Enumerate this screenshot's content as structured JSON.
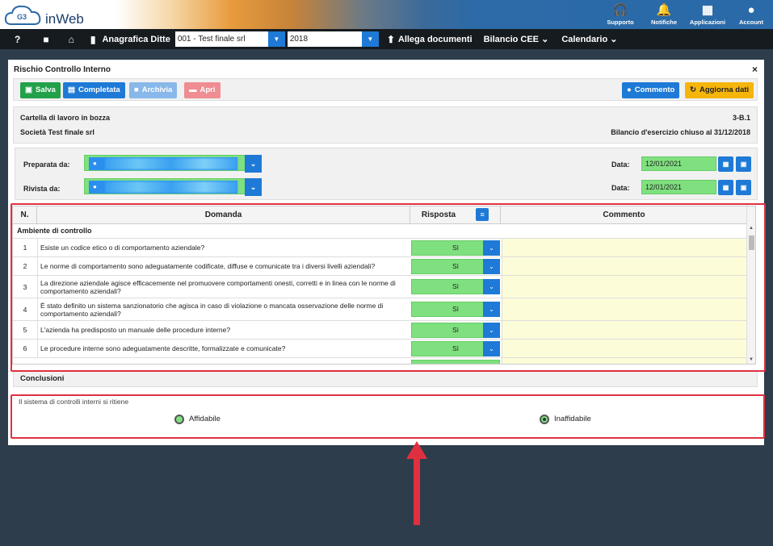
{
  "app": {
    "logo_text": "inWeb",
    "logo_mark": "G3"
  },
  "top_icons": [
    {
      "label": "Supporto",
      "icon": "headset-icon"
    },
    {
      "label": "Notifiche",
      "icon": "bell-icon"
    },
    {
      "label": "Applicazioni",
      "icon": "grid-icon"
    },
    {
      "label": "Account",
      "icon": "user-icon"
    }
  ],
  "nav": {
    "help": "?",
    "anagrafica": "Anagrafica Ditte",
    "company": "001 - Test finale srl",
    "year": "2018",
    "allega": "Allega documenti",
    "bilancio": "Bilancio CEE",
    "calendario": "Calendario"
  },
  "modal": {
    "title": "Rischio Controllo Interno",
    "close": "×"
  },
  "toolbar": {
    "salva": "Salva",
    "completata": "Completata",
    "archivia": "Archivia",
    "apri": "Apri",
    "commento": "Commento",
    "aggiorna": "Aggiorna dati"
  },
  "info": {
    "status": "Cartella di lavoro in bozza",
    "code": "3-B.1",
    "company": "Società Test finale srl",
    "period": "Bilancio d'esercizio chiuso al 31/12/2018"
  },
  "prep": {
    "preparata_label": "Preparata da:",
    "rivista_label": "Rivista da:",
    "data_label": "Data:",
    "date1": "12/01/2021",
    "date2": "12/01/2021"
  },
  "table": {
    "headers": {
      "n": "N.",
      "domanda": "Domanda",
      "risposta": "Risposta",
      "commento": "Commento"
    },
    "section": "Ambiente di controllo",
    "rows": [
      {
        "n": "1",
        "q": "Esiste un codice etico o di comportamento aziendale?",
        "a": "Sì"
      },
      {
        "n": "2",
        "q": "Le norme di comportamento sono adeguatamente codificate, diffuse e comunicate tra i diversi livelli aziendali?",
        "a": "Sì"
      },
      {
        "n": "3",
        "q": "La direzione aziendale agisce efficacemente nel promuovere comportamenti onesti, corretti e in linea con le norme di comportamento aziendali?",
        "a": "Sì"
      },
      {
        "n": "4",
        "q": "È stato definito un sistema sanzionatorio che agisca in caso di violazione o mancata osservazione delle norme di comportamento aziendali?",
        "a": "Sì"
      },
      {
        "n": "5",
        "q": "L'azienda ha predisposto un manuale delle procedure interne?",
        "a": "Sì"
      },
      {
        "n": "6",
        "q": "Le procedure interne sono adeguatamente descritte, formalizzate e comunicate?",
        "a": "Sì"
      }
    ]
  },
  "conclusioni": {
    "title": "Conclusioni",
    "question": "Il sistema di controlli interni si ritiene",
    "opt1": "Affidabile",
    "opt2": "Inaffidabile",
    "selected": "Inaffidabile"
  },
  "colors": {
    "green": "#7fe07f",
    "blue": "#1e7ad6",
    "red_highlight": "#e03040"
  }
}
